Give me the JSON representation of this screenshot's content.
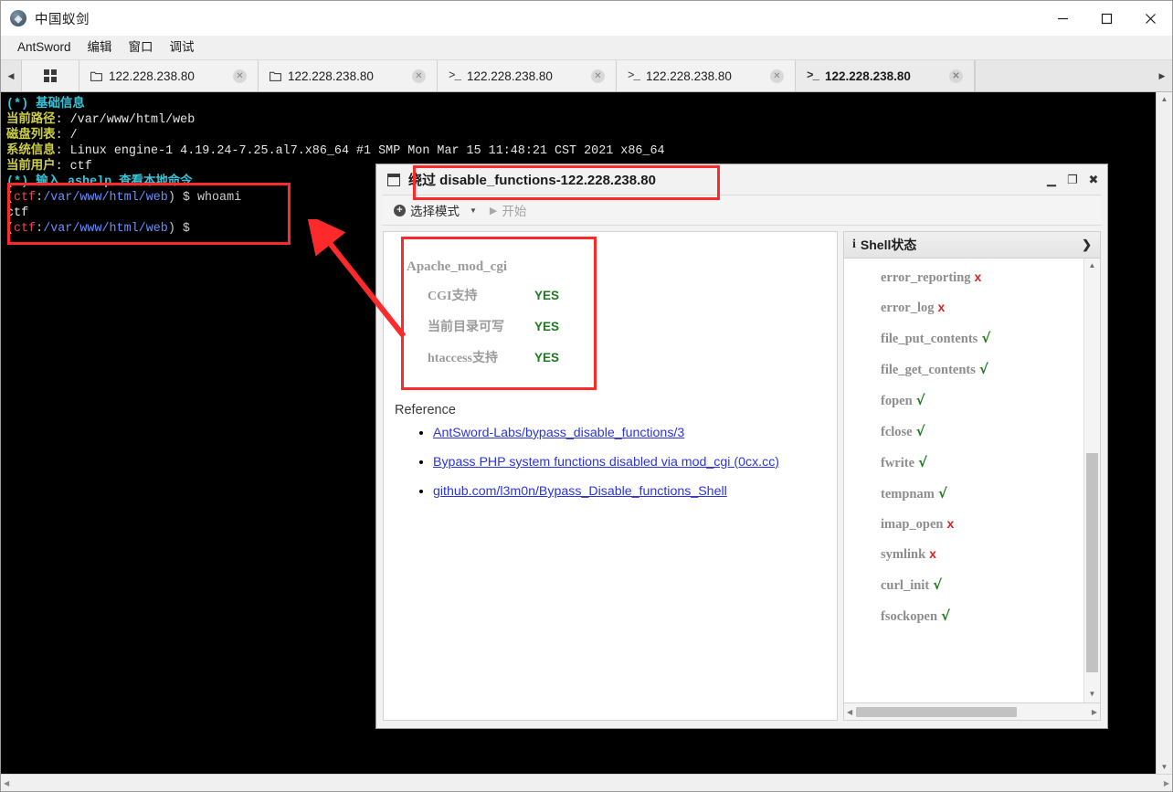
{
  "app": {
    "title": "中国蚁剑",
    "icon": "antsword-logo-icon",
    "window_controls": {
      "minimize": "minimize-icon",
      "maximize": "maximize-icon",
      "close": "close-icon"
    }
  },
  "menubar": {
    "items": [
      {
        "label": "AntSword"
      },
      {
        "label": "编辑"
      },
      {
        "label": "窗口"
      },
      {
        "label": "调试"
      }
    ]
  },
  "tabs": {
    "scroll_left": "◀",
    "scroll_right": "▶",
    "grid_button": "grid-icon",
    "close_glyph": "✕",
    "items": [
      {
        "label": "122.228.238.80",
        "icon": "folder-icon",
        "icon_glyph": "☐",
        "active": false
      },
      {
        "label": "122.228.238.80",
        "icon": "folder-icon",
        "icon_glyph": "☐",
        "active": false
      },
      {
        "label": "122.228.238.80",
        "icon": "terminal-icon",
        "icon_glyph": ">_",
        "active": false
      },
      {
        "label": "122.228.238.80",
        "icon": "terminal-icon",
        "icon_glyph": ">_",
        "active": false
      },
      {
        "label": "122.228.238.80",
        "icon": "terminal-icon",
        "icon_glyph": ">_",
        "active": true
      }
    ]
  },
  "terminal": {
    "lines": [
      {
        "segments": [
          {
            "text": "(*) 基础信息",
            "class": "t-cyan"
          }
        ]
      },
      {
        "segments": [
          {
            "text": "当前路径",
            "class": "t-yellow"
          },
          {
            "text": ": /var/www/html/web",
            "class": "t-white"
          }
        ]
      },
      {
        "segments": [
          {
            "text": "磁盘列表",
            "class": "t-yellow"
          },
          {
            "text": ": /",
            "class": "t-white"
          }
        ]
      },
      {
        "segments": [
          {
            "text": "系统信息",
            "class": "t-yellow"
          },
          {
            "text": ": Linux engine-1 4.19.24-7.25.al7.x86_64 #1 SMP Mon Mar 15 11:48:21 CST 2021 x86_64",
            "class": "t-white"
          }
        ]
      },
      {
        "segments": [
          {
            "text": "当前用户",
            "class": "t-yellow"
          },
          {
            "text": ": ctf",
            "class": "t-white"
          }
        ]
      },
      {
        "segments": [
          {
            "text": "(*) 输入 ashelp 查看本地命令",
            "class": "t-cyan"
          }
        ]
      },
      {
        "segments": [
          {
            "text": "(",
            "class": "t-grey"
          },
          {
            "text": "ctf",
            "class": "t-red"
          },
          {
            "text": ":",
            "class": "t-grey"
          },
          {
            "text": "/var/www/html/web",
            "class": "t-blue"
          },
          {
            "text": ") $ whoami",
            "class": "t-grey"
          }
        ]
      },
      {
        "segments": [
          {
            "text": "ctf",
            "class": "t-white"
          }
        ]
      },
      {
        "segments": [
          {
            "text": "(",
            "class": "t-grey"
          },
          {
            "text": "ctf",
            "class": "t-red"
          },
          {
            "text": ":",
            "class": "t-grey"
          },
          {
            "text": "/var/www/html/web",
            "class": "t-blue"
          },
          {
            "text": ") $ ",
            "class": "t-grey"
          }
        ]
      }
    ]
  },
  "dialog": {
    "title": "绕过 disable_functions-122.228.238.80",
    "icon": "window-icon",
    "controls": {
      "minimize": "▁",
      "maximize": "❐",
      "close": "✖"
    },
    "toolbar": {
      "mode_label": "选择模式",
      "plus_icon": "plus-circle-icon",
      "caret": "▼",
      "play_icon": "▶",
      "start_label": "开始"
    },
    "module": {
      "title": "Apache_mod_cgi",
      "rows": [
        {
          "label": "CGI支持",
          "value": "YES"
        },
        {
          "label": "当前目录可写",
          "value": "YES"
        },
        {
          "label": "htaccess支持",
          "value": "YES"
        }
      ]
    },
    "reference": {
      "heading": "Reference",
      "links": [
        {
          "text": "AntSword-Labs/bypass_disable_functions/3"
        },
        {
          "text": "Bypass PHP system functions disabled via mod_cgi (0cx.cc)"
        },
        {
          "text": "github.com/l3m0n/Bypass_Disable_functions_Shell"
        }
      ]
    },
    "shell_status": {
      "info_icon": "info-icon",
      "title": "Shell状态",
      "chevron": "❯",
      "functions": [
        {
          "name": "error_reporting",
          "status": "x",
          "ok": false
        },
        {
          "name": "error_log",
          "status": "x",
          "ok": false
        },
        {
          "name": "file_put_contents",
          "status": "√",
          "ok": true
        },
        {
          "name": "file_get_contents",
          "status": "√",
          "ok": true
        },
        {
          "name": "fopen",
          "status": "√",
          "ok": true
        },
        {
          "name": "fclose",
          "status": "√",
          "ok": true
        },
        {
          "name": "fwrite",
          "status": "√",
          "ok": true
        },
        {
          "name": "tempnam",
          "status": "√",
          "ok": true
        },
        {
          "name": "imap_open",
          "status": "x",
          "ok": false
        },
        {
          "name": "symlink",
          "status": "x",
          "ok": false
        },
        {
          "name": "curl_init",
          "status": "√",
          "ok": true
        },
        {
          "name": "fsockopen",
          "status": "√",
          "ok": true
        }
      ]
    }
  },
  "annotations": {
    "highlight_color": "#fc2a2a",
    "boxes": [
      {
        "name": "terminal-command-highlight"
      },
      {
        "name": "dialog-title-highlight"
      },
      {
        "name": "module-card-highlight"
      }
    ],
    "arrow": {
      "name": "pointer-arrow"
    }
  },
  "scrollbars": {
    "up_arrow": "▲",
    "down_arrow": "▼",
    "left_arrow": "◀",
    "right_arrow": "▶"
  }
}
